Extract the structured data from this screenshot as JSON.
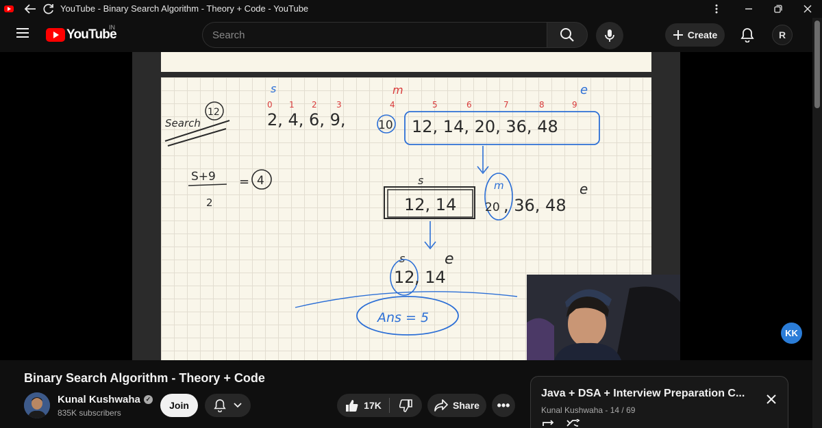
{
  "window": {
    "title": "YouTube - Binary Search Algorithm - Theory + Code - YouTube",
    "icons": [
      "youtube-app-icon",
      "back-arrow-icon",
      "reload-icon",
      "more-vertical-icon",
      "minimize-icon",
      "restore-icon",
      "close-icon"
    ]
  },
  "masthead": {
    "logo_text": "YouTube",
    "region": "IN",
    "search_placeholder": "Search",
    "create_label": "Create",
    "avatar_initials": "R"
  },
  "player": {
    "notes": {
      "search_label": "Search",
      "target": "12",
      "start_marker": "s",
      "end_marker": "e",
      "mid_marker": "m",
      "indices": [
        "0",
        "1",
        "2",
        "3",
        "4",
        "5",
        "6",
        "7",
        "8",
        "9"
      ],
      "array": "2, 4, 6, 9, 10, 12, 14, 20, 36, 48",
      "array_left": "2, 4, 6, 9,",
      "array_mid": "10",
      "array_right": "12, 14, 20, 36, 48",
      "formula_top": "S+9",
      "formula_bottom": "2",
      "formula_result": "=",
      "formula_value": "4",
      "step2_box": "12, 14",
      "step2_mid": "20",
      "step2_rest": ", 36, 48",
      "step3_mid": "12",
      "step3_rest": ", 14",
      "answer": "Ans = 5"
    },
    "channel_badge": "KK"
  },
  "video": {
    "title": "Binary Search Algorithm - Theory + Code",
    "channel": "Kunal Kushwaha",
    "subscribers": "835K subscribers",
    "join_label": "Join",
    "likes": "17K",
    "share_label": "Share"
  },
  "playlist": {
    "title": "Java + DSA + Interview Preparation C...",
    "subtitle": "Kunal Kushwaha - 14 / 69"
  },
  "colors": {
    "background": "#0f0f0f",
    "brand_red": "#ff0000",
    "ink_blue": "#2c6fd6",
    "ink_red": "#d83a3a",
    "ink_dark": "#2a2a2a"
  }
}
